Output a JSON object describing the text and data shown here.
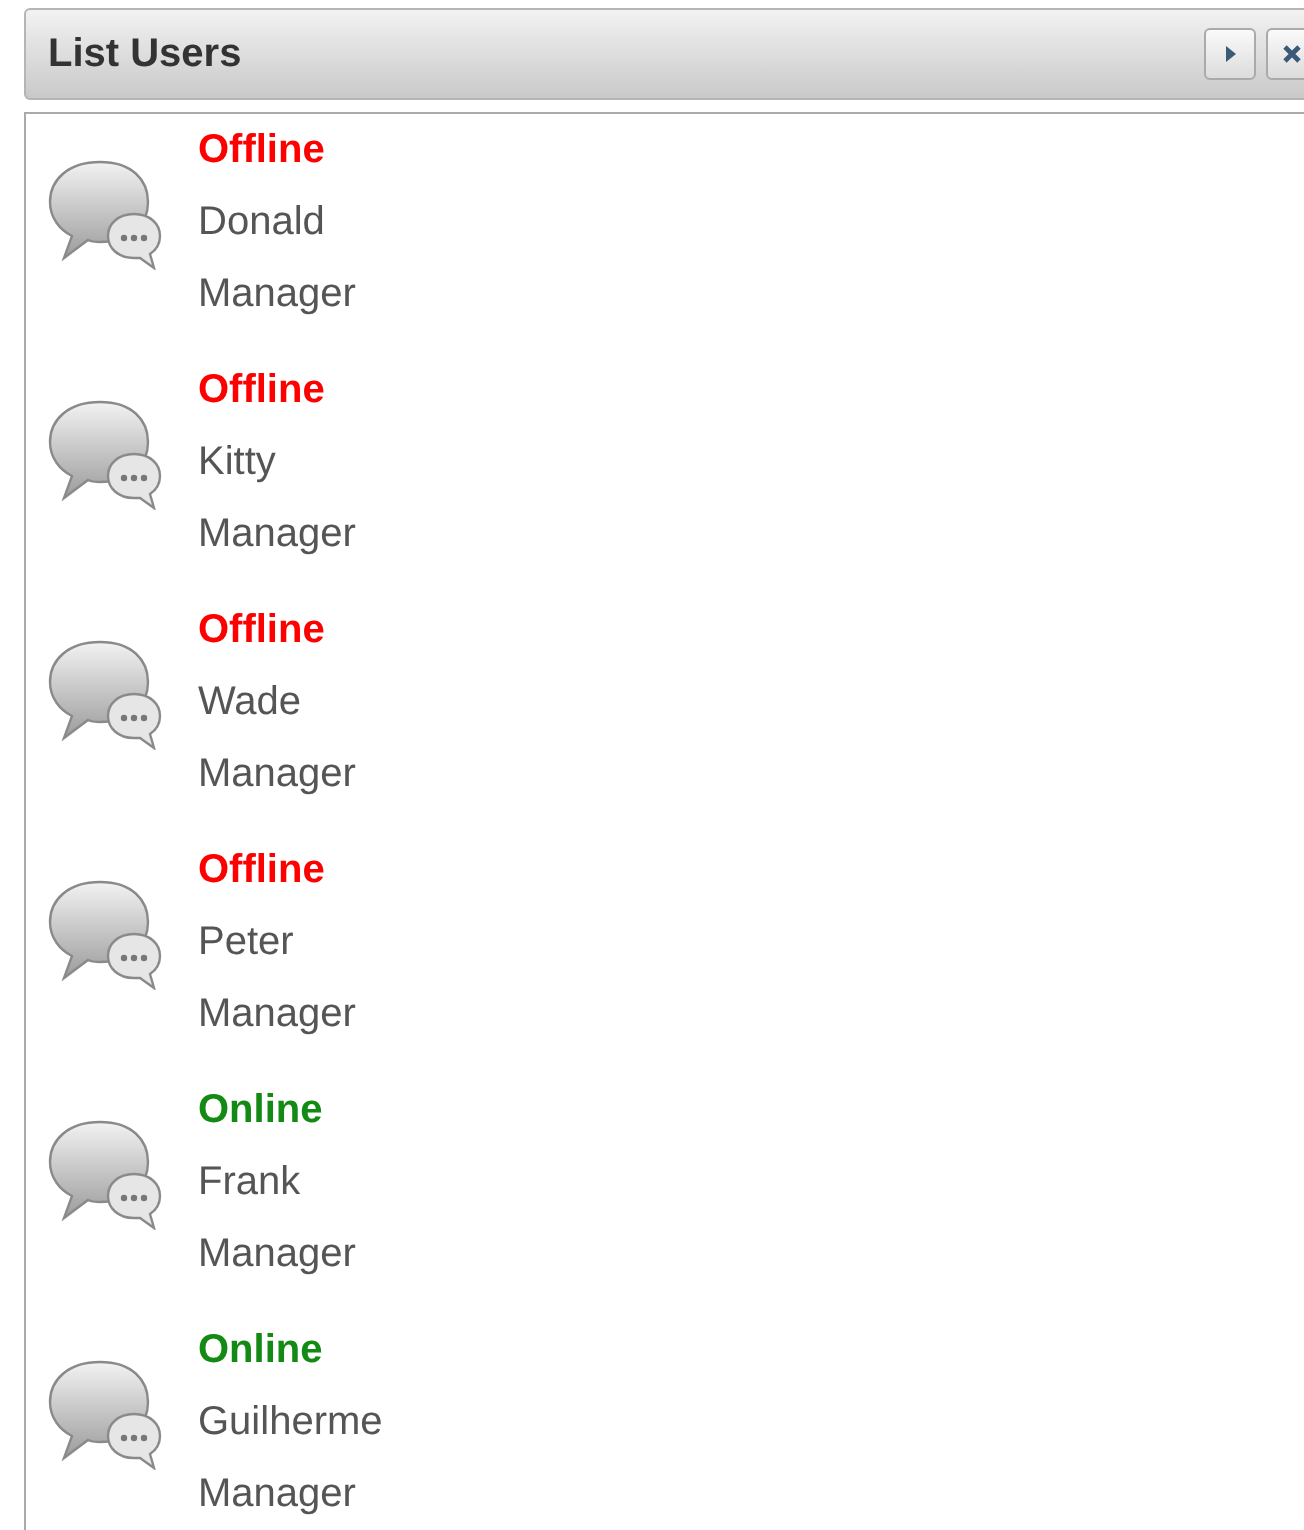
{
  "panel": {
    "title": "List Users"
  },
  "users": [
    {
      "status": "Offline",
      "online": false,
      "name": "Donald",
      "role": "Manager"
    },
    {
      "status": "Offline",
      "online": false,
      "name": "Kitty",
      "role": "Manager"
    },
    {
      "status": "Offline",
      "online": false,
      "name": "Wade",
      "role": "Manager"
    },
    {
      "status": "Offline",
      "online": false,
      "name": "Peter",
      "role": "Manager"
    },
    {
      "status": "Online",
      "online": true,
      "name": "Frank",
      "role": "Manager"
    },
    {
      "status": "Online",
      "online": true,
      "name": "Guilherme",
      "role": "Manager"
    }
  ]
}
